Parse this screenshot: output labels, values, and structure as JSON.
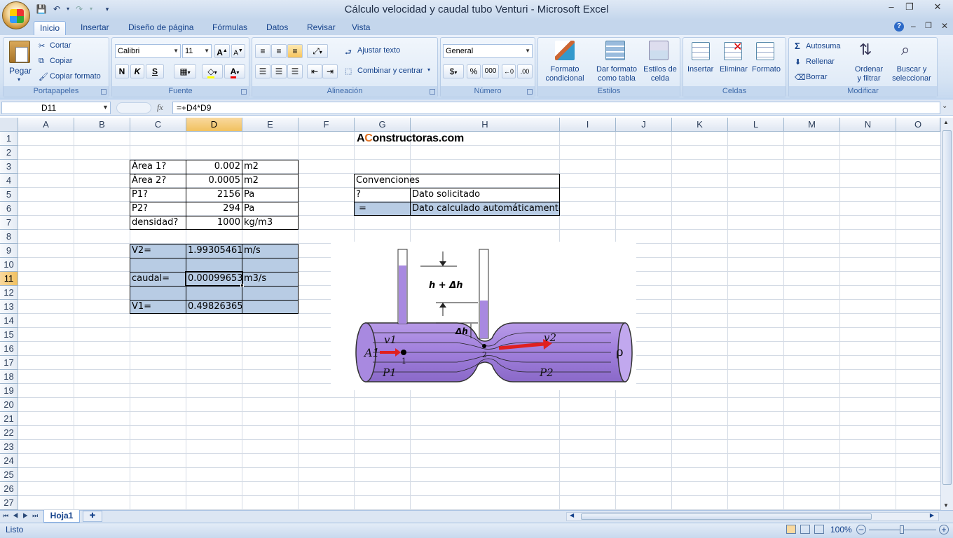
{
  "window": {
    "title": "Cálculo velocidad y caudal tubo Venturi - Microsoft Excel"
  },
  "ribbon_tabs": [
    "Inicio",
    "Insertar",
    "Diseño de página",
    "Fórmulas",
    "Datos",
    "Revisar",
    "Vista"
  ],
  "clipboard": {
    "paste": "Pegar",
    "cut": "Cortar",
    "copy": "Copiar",
    "format_painter": "Copiar formato",
    "label": "Portapapeles"
  },
  "font": {
    "name": "Calibri",
    "size": "11",
    "bold": "N",
    "italic": "K",
    "underline": "S",
    "label": "Fuente"
  },
  "alignment": {
    "wrap": "Ajustar texto",
    "merge": "Combinar y centrar",
    "label": "Alineación"
  },
  "number": {
    "format": "General",
    "currency": "$",
    "percent": "%",
    "thousands": "000",
    "label": "Número"
  },
  "styles": {
    "conditional": "Formato condicional",
    "as_table": "Dar formato como tabla",
    "cell_styles": "Estilos de celda",
    "label": "Estilos"
  },
  "cells": {
    "insert": "Insertar",
    "delete": "Eliminar",
    "format": "Formato",
    "label": "Celdas"
  },
  "editing": {
    "autosum": "Autosuma",
    "fill": "Rellenar",
    "clear": "Borrar",
    "sort": "Ordenar y filtrar",
    "find": "Buscar y seleccionar",
    "label": "Modificar"
  },
  "formula_bar": {
    "name_box": "D11",
    "fx": "fx",
    "formula": "=+D4*D9"
  },
  "columns": [
    "A",
    "B",
    "C",
    "D",
    "E",
    "F",
    "G",
    "H",
    "I",
    "J",
    "K",
    "L",
    "M",
    "N",
    "O"
  ],
  "rows": [
    "1",
    "2",
    "3",
    "4",
    "5",
    "6",
    "7",
    "8",
    "9",
    "10",
    "11",
    "12",
    "13",
    "14",
    "15",
    "16",
    "17",
    "18",
    "19",
    "20",
    "21",
    "22",
    "23",
    "24",
    "25",
    "26",
    "27"
  ],
  "selected": {
    "column": "D",
    "row": "11"
  },
  "sheet": {
    "logo_a": "A",
    "logo_c": "C",
    "logo_rest": "onstructoras.com",
    "inputs": [
      {
        "label": "Área 1?",
        "value": "0.002",
        "unit": "m2"
      },
      {
        "label": "Área 2?",
        "value": "0.0005",
        "unit": "m2"
      },
      {
        "label": "P1?",
        "value": "2156",
        "unit": "Pa"
      },
      {
        "label": "P2?",
        "value": "294",
        "unit": "Pa"
      },
      {
        "label": "densidad?",
        "value": "1000",
        "unit": "kg/m3"
      }
    ],
    "results": {
      "v2_label": "V2=",
      "v2_value": "1.99305461",
      "v2_unit": "m/s",
      "q_label": "caudal=",
      "q_value": "0.00099653",
      "q_unit": "m3/s",
      "v1_label": "V1=",
      "v1_value": "0.49826365"
    },
    "conventions": {
      "title": "Convenciones",
      "q_symbol": "?",
      "q_desc": "Dato solicitado",
      "eq_symbol": "=",
      "eq_desc": "Dato calculado automáticamente"
    },
    "diagram": {
      "h_label": "h  +  Δh",
      "dh_label": "Δh",
      "v1": "v1",
      "v2": "v2",
      "a1": "A1",
      "p1": "P1",
      "p2": "P2",
      "rho": "ρ",
      "pt1": "1",
      "pt2": "2"
    }
  },
  "sheet_tabs": [
    "Hoja1"
  ],
  "status": {
    "ready": "Listo",
    "zoom": "100%"
  }
}
